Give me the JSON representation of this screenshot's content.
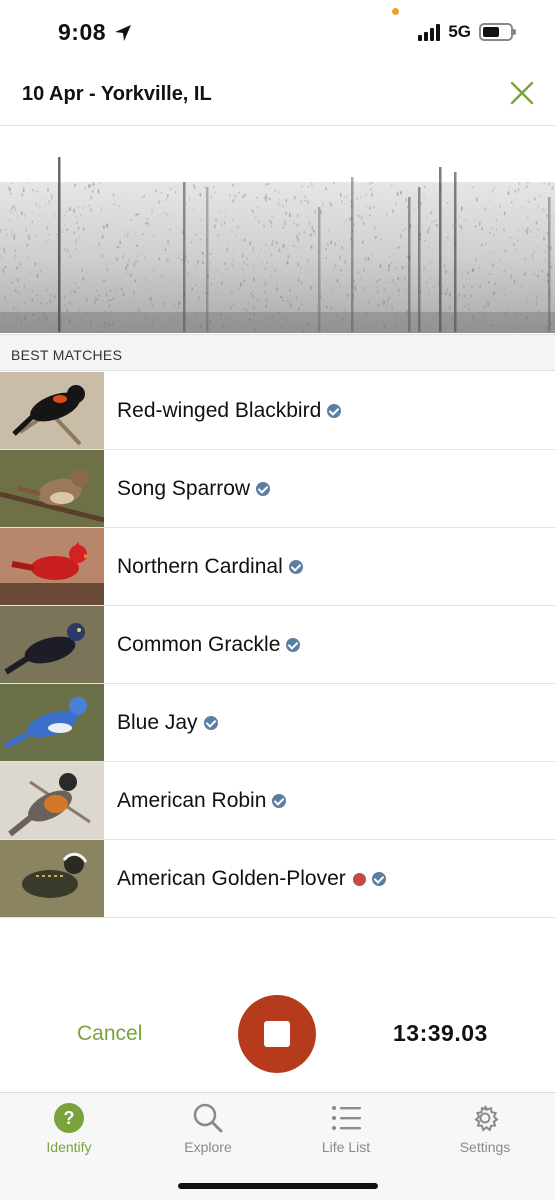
{
  "status_bar": {
    "time": "9:08",
    "network": "5G"
  },
  "header": {
    "title": "10 Apr - Yorkville, IL"
  },
  "section": {
    "best_matches": "BEST MATCHES"
  },
  "matches": [
    {
      "name": "Red-winged Blackbird",
      "verified": true,
      "rare": false
    },
    {
      "name": "Song Sparrow",
      "verified": true,
      "rare": false
    },
    {
      "name": "Northern Cardinal",
      "verified": true,
      "rare": false
    },
    {
      "name": "Common Grackle",
      "verified": true,
      "rare": false
    },
    {
      "name": "Blue Jay",
      "verified": true,
      "rare": false
    },
    {
      "name": "American Robin",
      "verified": true,
      "rare": false
    },
    {
      "name": "American Golden-Plover",
      "verified": true,
      "rare": true
    }
  ],
  "controls": {
    "cancel_label": "Cancel",
    "timer": "13:39.03"
  },
  "tabs": [
    {
      "label": "Identify",
      "icon": "question-circle-icon",
      "active": true
    },
    {
      "label": "Explore",
      "icon": "search-icon",
      "active": false
    },
    {
      "label": "Life List",
      "icon": "list-icon",
      "active": false
    },
    {
      "label": "Settings",
      "icon": "gear-icon",
      "active": false
    }
  ],
  "colors": {
    "accent_green": "#7aa33c",
    "record_red": "#b53b1c",
    "verified_blue": "#5b7fa3",
    "rare_red": "#c44a48"
  }
}
